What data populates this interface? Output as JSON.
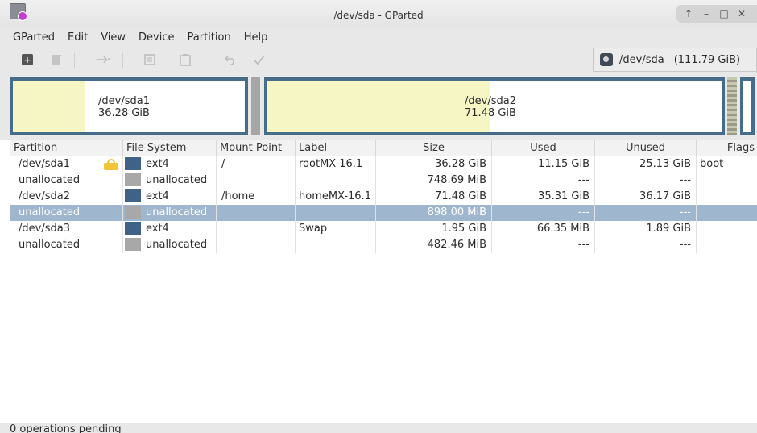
{
  "window": {
    "title": "/dev/sda - GParted",
    "icon": "gparted-app-icon",
    "buttons": [
      "up-icon",
      "minimize-icon",
      "maximize-icon",
      "close-icon"
    ]
  },
  "menubar": {
    "items": [
      "GParted",
      "Edit",
      "View",
      "Device",
      "Partition",
      "Help"
    ]
  },
  "toolbar": {
    "buttons": [
      {
        "name": "new-partition",
        "icon": "new-icon"
      },
      {
        "name": "delete-partition",
        "icon": "trash-icon"
      },
      {
        "name": "resize-move",
        "icon": "resize-icon"
      },
      {
        "name": "copy",
        "icon": "copy-icon"
      },
      {
        "name": "paste",
        "icon": "paste-icon"
      },
      {
        "name": "undo",
        "icon": "undo-icon"
      },
      {
        "name": "apply",
        "icon": "apply-icon"
      }
    ]
  },
  "device_selector": {
    "device": "/dev/sda",
    "size": "(111.79 GiB)"
  },
  "disk_map": {
    "partitions": [
      {
        "name": "/dev/sda1",
        "size": "36.28 GiB",
        "used_fraction": 0.31
      },
      {
        "name": "/dev/sda2",
        "size": "71.48 GiB",
        "used_fraction": 0.49
      }
    ]
  },
  "table": {
    "columns": [
      "Partition",
      "File System",
      "Mount Point",
      "Label",
      "Size",
      "Used",
      "Unused",
      "Flags"
    ],
    "rows": [
      {
        "partition": "/dev/sda1",
        "locked": true,
        "fs": "ext4",
        "fs_color": "#3e6387",
        "mount": "/",
        "label": "rootMX-16.1",
        "size": "36.28 GiB",
        "used": "11.15 GiB",
        "unused": "25.13 GiB",
        "flags": "boot",
        "selected": false
      },
      {
        "partition": "unallocated",
        "locked": false,
        "fs": "unallocated",
        "fs_color": "#a8a8a8",
        "mount": "",
        "label": "",
        "size": "748.69 MiB",
        "used": "---",
        "unused": "---",
        "flags": "",
        "selected": false
      },
      {
        "partition": "/dev/sda2",
        "locked": false,
        "fs": "ext4",
        "fs_color": "#3e6387",
        "mount": "/home",
        "label": "homeMX-16.1",
        "size": "71.48 GiB",
        "used": "35.31 GiB",
        "unused": "36.17 GiB",
        "flags": "",
        "selected": false
      },
      {
        "partition": "unallocated",
        "locked": false,
        "fs": "unallocated",
        "fs_color": "#a8a8a8",
        "mount": "",
        "label": "",
        "size": "898.00 MiB",
        "used": "---",
        "unused": "---",
        "flags": "",
        "selected": true
      },
      {
        "partition": "/dev/sda3",
        "locked": false,
        "fs": "ext4",
        "fs_color": "#3e6387",
        "mount": "",
        "label": "Swap",
        "size": "1.95 GiB",
        "used": "66.35 MiB",
        "unused": "1.89 GiB",
        "flags": "",
        "selected": false
      },
      {
        "partition": "unallocated",
        "locked": false,
        "fs": "unallocated",
        "fs_color": "#a8a8a8",
        "mount": "",
        "label": "",
        "size": "482.46 MiB",
        "used": "---",
        "unused": "---",
        "flags": "",
        "selected": false
      }
    ]
  },
  "status": {
    "text": "0 operations pending"
  }
}
